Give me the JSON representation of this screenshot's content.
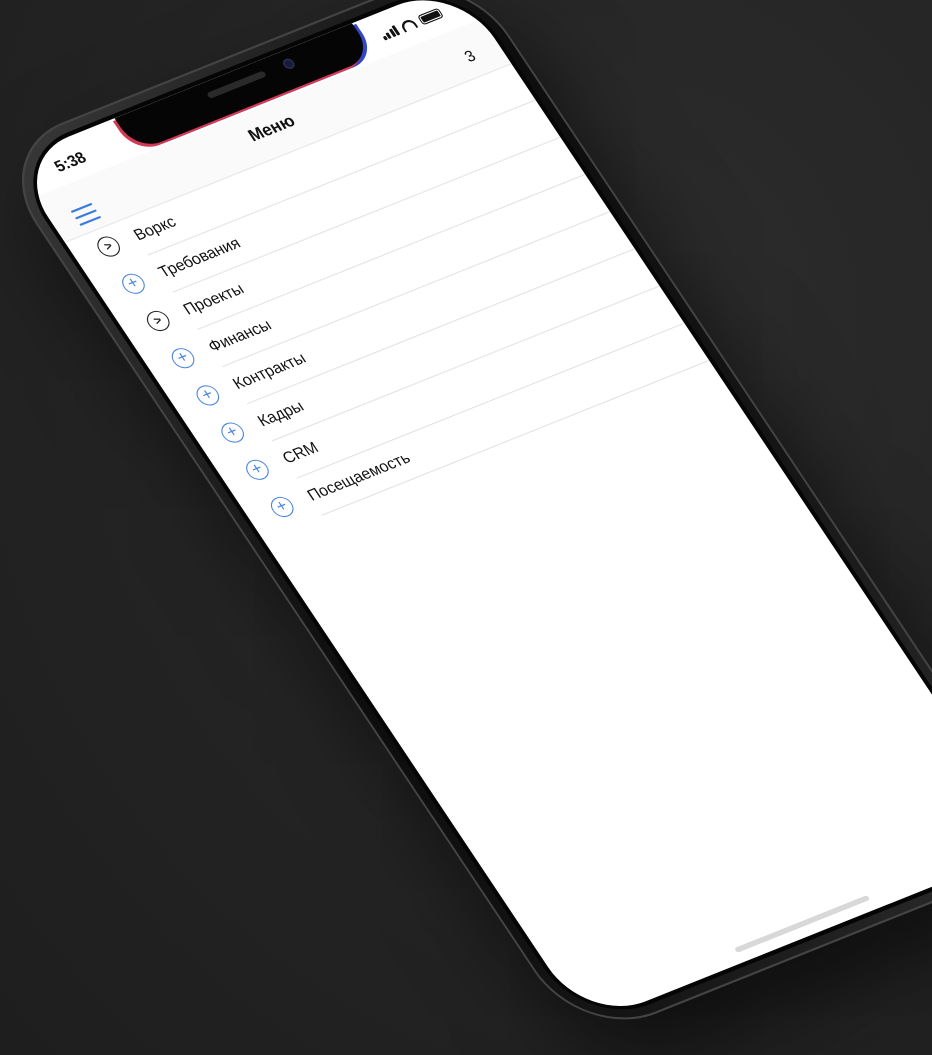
{
  "status_bar": {
    "time": "5:38"
  },
  "nav": {
    "title": "Меню",
    "menu_icon": "hamburger-icon"
  },
  "menu": {
    "badge": "3",
    "items": [
      {
        "label": "Воркс",
        "icon": "chevron-right-circle-icon"
      },
      {
        "label": "Требования",
        "icon": "plus-circle-icon"
      },
      {
        "label": "Проекты",
        "icon": "chevron-right-circle-icon"
      },
      {
        "label": "Финансы",
        "icon": "plus-circle-icon"
      },
      {
        "label": "Контракты",
        "icon": "plus-circle-icon"
      },
      {
        "label": "Кадры",
        "icon": "plus-circle-icon"
      },
      {
        "label": "CRM",
        "icon": "plus-circle-icon"
      },
      {
        "label": "Посещаемость",
        "icon": "plus-circle-icon"
      }
    ]
  },
  "colors": {
    "accent": "#4a86e0",
    "notch_left": "#d23a55",
    "notch_right": "#3346c8",
    "background": "#252525"
  }
}
